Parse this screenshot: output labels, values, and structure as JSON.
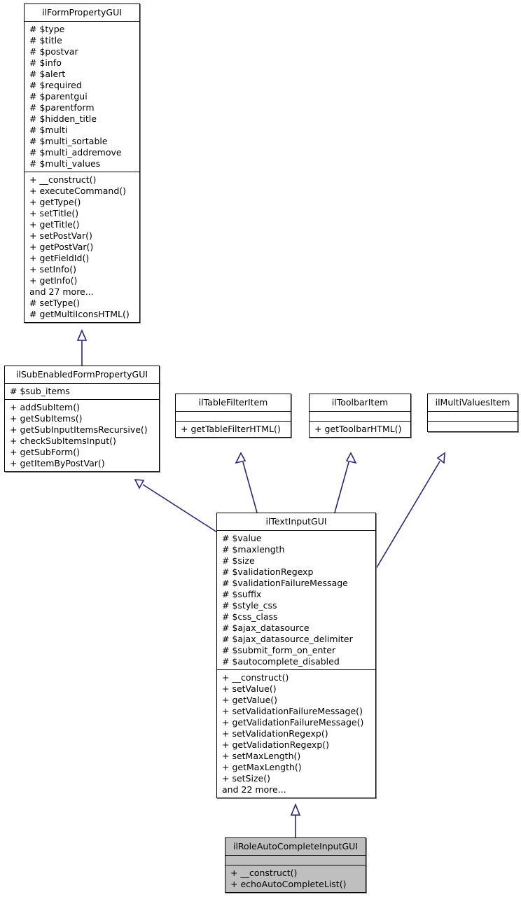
{
  "diagram": {
    "type": "uml-class-inheritance-diagram",
    "colors": {
      "node_fill": "#ffffff",
      "node_highlight_fill": "#bfbfbf",
      "node_border": "#000000",
      "edge": "#27277f",
      "text": "#000000"
    },
    "nodes": [
      {
        "id": "ilFormPropertyGUI",
        "name": "ilFormPropertyGUI",
        "highlighted": false,
        "attributes": [
          "# $type",
          "# $title",
          "# $postvar",
          "# $info",
          "# $alert",
          "# $required",
          "# $parentgui",
          "# $parentform",
          "# $hidden_title",
          "# $multi",
          "# $multi_sortable",
          "# $multi_addremove",
          "# $multi_values"
        ],
        "operations": [
          "+ __construct()",
          "+ executeCommand()",
          "+ getType()",
          "+ setTitle()",
          "+ getTitle()",
          "+ setPostVar()",
          "+ getPostVar()",
          "+ getFieldId()",
          "+ setInfo()",
          "+ getInfo()",
          "and 27 more...",
          "# setType()",
          "# getMultiIconsHTML()"
        ]
      },
      {
        "id": "ilSubEnabledFormPropertyGUI",
        "name": "ilSubEnabledFormPropertyGUI",
        "highlighted": false,
        "attributes": [
          "# $sub_items"
        ],
        "operations": [
          "+ addSubItem()",
          "+ getSubItems()",
          "+ getSubInputItemsRecursive()",
          "+ checkSubItemsInput()",
          "+ getSubForm()",
          "+ getItemByPostVar()"
        ]
      },
      {
        "id": "ilTableFilterItem",
        "name": "ilTableFilterItem",
        "highlighted": false,
        "attributes": [],
        "operations": [
          "+ getTableFilterHTML()"
        ]
      },
      {
        "id": "ilToolbarItem",
        "name": "ilToolbarItem",
        "highlighted": false,
        "attributes": [],
        "operations": [
          "+ getToolbarHTML()"
        ]
      },
      {
        "id": "ilMultiValuesItem",
        "name": "ilMultiValuesItem",
        "highlighted": false,
        "attributes": [],
        "operations": []
      },
      {
        "id": "ilTextInputGUI",
        "name": "ilTextInputGUI",
        "highlighted": false,
        "attributes": [
          "# $value",
          "# $maxlength",
          "# $size",
          "# $validationRegexp",
          "# $validationFailureMessage",
          "# $suffix",
          "# $style_css",
          "# $css_class",
          "# $ajax_datasource",
          "# $ajax_datasource_delimiter",
          "# $submit_form_on_enter",
          "# $autocomplete_disabled"
        ],
        "operations": [
          "+ __construct()",
          "+ setValue()",
          "+ getValue()",
          "+ setValidationFailureMessage()",
          "+ getValidationFailureMessage()",
          "+ setValidationRegexp()",
          "+ getValidationRegexp()",
          "+ setMaxLength()",
          "+ getMaxLength()",
          "+ setSize()",
          "and 22 more..."
        ]
      },
      {
        "id": "ilRoleAutoCompleteInputGUI",
        "name": "ilRoleAutoCompleteInputGUI",
        "highlighted": true,
        "attributes": [],
        "operations": [
          "+ __construct()",
          "+ echoAutoCompleteList()"
        ]
      }
    ],
    "edges": [
      {
        "from": "ilSubEnabledFormPropertyGUI",
        "to": "ilFormPropertyGUI",
        "kind": "inheritance"
      },
      {
        "from": "ilTextInputGUI",
        "to": "ilSubEnabledFormPropertyGUI",
        "kind": "inheritance"
      },
      {
        "from": "ilTextInputGUI",
        "to": "ilTableFilterItem",
        "kind": "inheritance"
      },
      {
        "from": "ilTextInputGUI",
        "to": "ilToolbarItem",
        "kind": "inheritance"
      },
      {
        "from": "ilTextInputGUI",
        "to": "ilMultiValuesItem",
        "kind": "inheritance"
      },
      {
        "from": "ilRoleAutoCompleteInputGUI",
        "to": "ilTextInputGUI",
        "kind": "inheritance"
      }
    ]
  }
}
